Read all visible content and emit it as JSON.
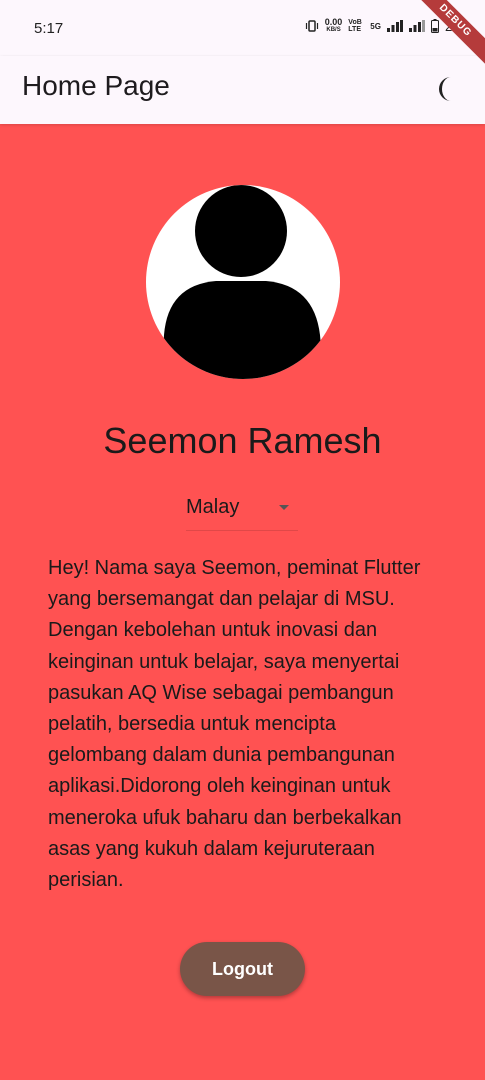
{
  "status_bar": {
    "time": "5:17",
    "net_speed_value": "0.00",
    "net_speed_unit": "KB/S",
    "volte_label": "VoB LTE",
    "network_type": "5G",
    "battery": "26%"
  },
  "debug_banner": "DEBUG",
  "app_bar": {
    "title": "Home Page",
    "theme_icon": "crescent-moon-icon"
  },
  "profile": {
    "name": "Seemon Ramesh",
    "avatar_icon": "person-icon"
  },
  "language": {
    "selected": "Malay"
  },
  "bio": "Hey! Nama saya Seemon, peminat Flutter yang bersemangat dan pelajar di MSU. Dengan kebolehan untuk inovasi dan keinginan untuk belajar, saya menyertai pasukan AQ Wise sebagai pembangun pelatih, bersedia untuk mencipta gelombang dalam dunia pembangunan aplikasi.Didorong oleh keinginan untuk meneroka ufuk baharu dan berbekalkan asas yang kukuh dalam kejuruteraan perisian.",
  "logout_label": "Logout",
  "colors": {
    "background": "#ff5252",
    "app_bar": "#fdf7fd",
    "logout_button": "#795548",
    "debug_ribbon": "#b53b3b"
  }
}
